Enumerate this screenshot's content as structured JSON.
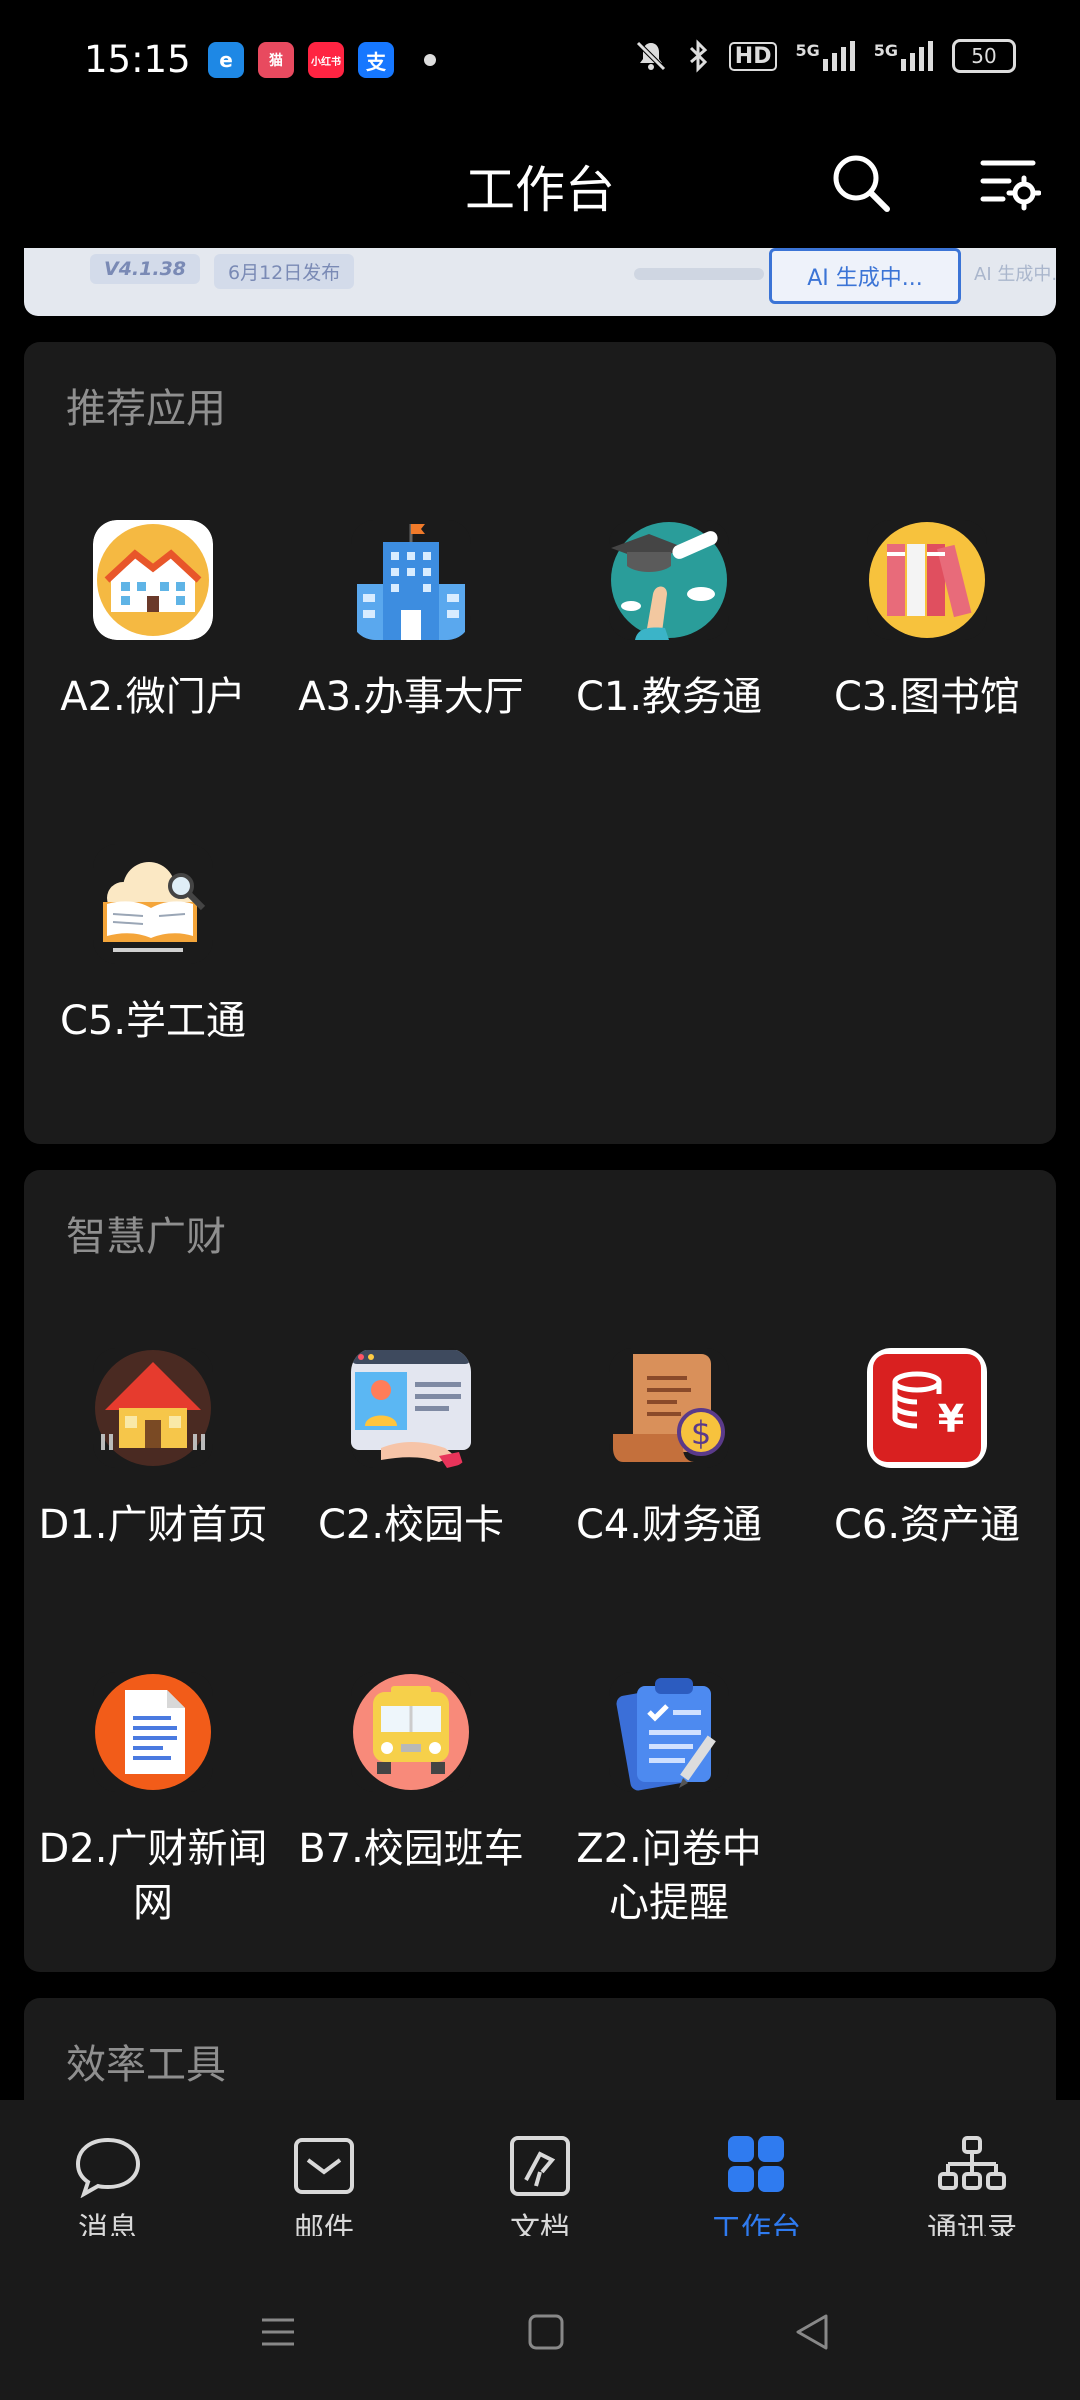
{
  "status_bar": {
    "time": "15:15",
    "app_icons": [
      "e-icon",
      "xiaoxin-icon",
      "hongshu-icon",
      "alipay-icon"
    ],
    "app_icon_labels": [
      "e",
      "猫",
      "小红书",
      "支"
    ],
    "network_1": "5G",
    "network_2": "5G",
    "hd": "HD",
    "battery": "50"
  },
  "header": {
    "title": "工作台"
  },
  "banner": {
    "version": "V4.1.38",
    "date": "6月12日发布",
    "ai_button": "AI 生成中...",
    "ai_button_2": "AI 生成中..."
  },
  "sections": [
    {
      "title": "推荐应用",
      "apps": [
        {
          "label": "A2.微门户",
          "icon": "micro-portal-icon"
        },
        {
          "label": "A3.办事大厅",
          "icon": "service-hall-icon"
        },
        {
          "label": "C1.教务通",
          "icon": "academic-icon"
        },
        {
          "label": "C3.图书馆",
          "icon": "library-icon"
        },
        {
          "label": "C5.学工通",
          "icon": "student-affairs-icon"
        }
      ]
    },
    {
      "title": "智慧广财",
      "apps": [
        {
          "label": "D1.广财首页",
          "icon": "home-house-icon"
        },
        {
          "label": "C2.校园卡",
          "icon": "campus-card-icon"
        },
        {
          "label": "C4.财务通",
          "icon": "finance-icon"
        },
        {
          "label": "C6.资产通",
          "icon": "assets-icon"
        },
        {
          "label": "D2.广财新闻网",
          "icon": "news-icon"
        },
        {
          "label": "B7.校园班车",
          "icon": "school-bus-icon"
        },
        {
          "label": "Z2.问卷中心提醒",
          "icon": "survey-icon"
        }
      ]
    },
    {
      "title": "效率工具"
    }
  ],
  "bottom_nav": [
    {
      "label": "消息",
      "icon": "message-icon",
      "active": false
    },
    {
      "label": "邮件",
      "icon": "mail-icon",
      "active": false
    },
    {
      "label": "文档",
      "icon": "document-icon",
      "active": false
    },
    {
      "label": "工作台",
      "icon": "workbench-icon",
      "active": true
    },
    {
      "label": "通讯录",
      "icon": "contacts-icon",
      "active": false
    }
  ],
  "colors": {
    "accent": "#2f7bf0",
    "card_bg": "#1b1b1b",
    "page_bg": "#000000"
  }
}
